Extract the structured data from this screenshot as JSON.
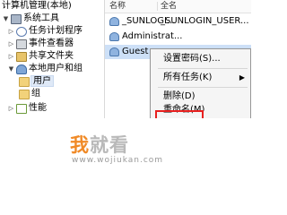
{
  "window": {
    "title": "计算机管理(本地)"
  },
  "tree": {
    "items": [
      {
        "label": "系统工具",
        "expander": "▼"
      },
      {
        "label": "任务计划程序",
        "expander": "▷"
      },
      {
        "label": "事件查看器",
        "expander": "▷"
      },
      {
        "label": "共享文件夹",
        "expander": "▷"
      },
      {
        "label": "本地用户和组",
        "expander": "▼"
      },
      {
        "label": "用户",
        "expander": ""
      },
      {
        "label": "组",
        "expander": ""
      },
      {
        "label": "性能",
        "expander": "▷"
      }
    ]
  },
  "list": {
    "columns": {
      "name": "名称",
      "fullname": "全名"
    },
    "rows": [
      {
        "name": "_SUNLOGI...",
        "fullname": "_SUNLOGIN_USER..."
      },
      {
        "name": "Administrat...",
        "fullname": ""
      },
      {
        "name": "Guest",
        "fullname": ""
      }
    ]
  },
  "context_menu": {
    "items": [
      {
        "label": "设置密码(S)...",
        "arrow": ""
      },
      {
        "label": "所有任务(K)",
        "arrow": "▶"
      },
      {
        "label": "删除(D)",
        "arrow": ""
      },
      {
        "label": "重命名(M)",
        "arrow": ""
      }
    ]
  },
  "watermark": {
    "first_char": "我",
    "rest": "就看",
    "url": "www.wojiukan.com"
  },
  "colors": {
    "highlight_box": "#e8201f",
    "watermark_accent": "#f08a27",
    "selection": "#cde0f7"
  }
}
